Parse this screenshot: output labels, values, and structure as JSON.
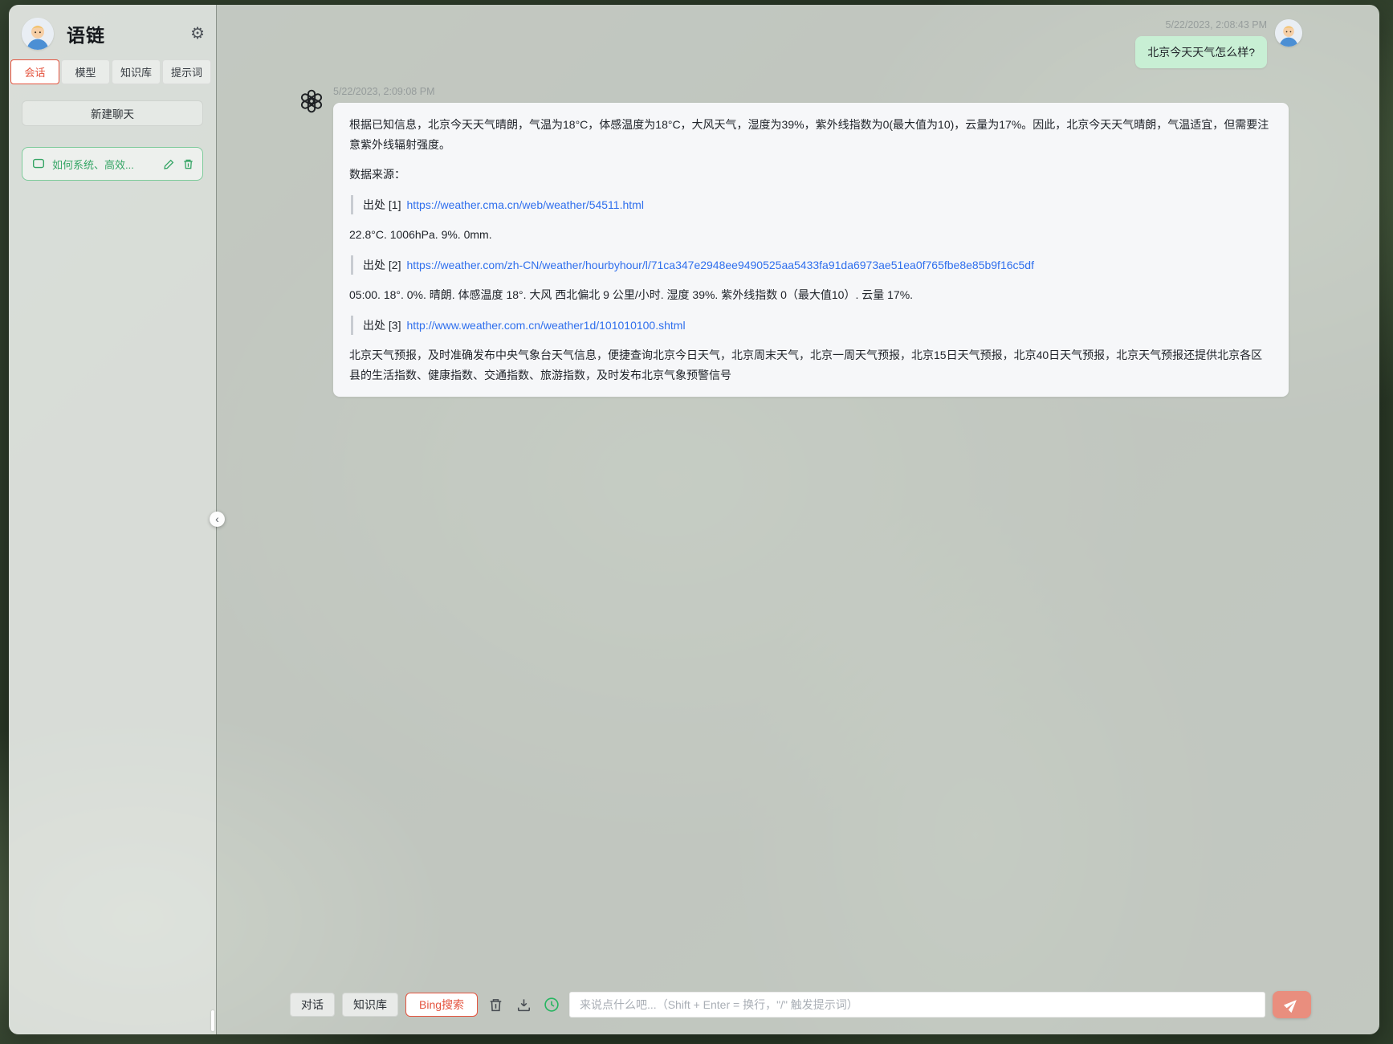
{
  "app": {
    "title": "语链"
  },
  "sidebar": {
    "tabs": [
      {
        "label": "会话",
        "active": true
      },
      {
        "label": "模型",
        "active": false
      },
      {
        "label": "知识库",
        "active": false
      },
      {
        "label": "提示词",
        "active": false
      }
    ],
    "new_chat_label": "新建聊天",
    "conversation": {
      "title": "如何系统、高效..."
    },
    "collapse_glyph": "‹"
  },
  "chat": {
    "user": {
      "timestamp": "5/22/2023, 2:08:43 PM",
      "text": "北京今天天气怎么样?"
    },
    "assistant": {
      "timestamp": "5/22/2023, 2:09:08 PM",
      "paragraph1": "根据已知信息，北京今天天气晴朗，气温为18°C，体感温度为18°C，大风天气，湿度为39%，紫外线指数为0(最大值为10)，云量为17%。因此，北京今天天气晴朗，气温适宜，但需要注意紫外线辐射强度。",
      "sources_heading": "数据来源：",
      "citations": [
        {
          "label": "出处 [1]",
          "url": "https://weather.cma.cn/web/weather/54511.html",
          "excerpt": "22.8°C. 1006hPa. 9%. 0mm."
        },
        {
          "label": "出处 [2]",
          "url": "https://weather.com/zh-CN/weather/hourbyhour/l/71ca347e2948ee9490525aa5433fa91da6973ae51ea0f765fbe8e85b9f16c5df",
          "excerpt": "05:00. 18°. 0%. 晴朗. 体感温度 18°. 大风 西北偏北 9 公里/小时. 湿度 39%. 紫外线指数 0（最大值10）. 云量 17%."
        },
        {
          "label": "出处 [3]",
          "url": "http://www.weather.com.cn/weather1d/101010100.shtml",
          "excerpt": "北京天气预报，及时准确发布中央气象台天气信息，便捷查询北京今日天气，北京周末天气，北京一周天气预报，北京15日天气预报，北京40日天气预报，北京天气预报还提供北京各区县的生活指数、健康指数、交通指数、旅游指数，及时发布北京气象预警信号"
        }
      ]
    }
  },
  "composer": {
    "mode_buttons": [
      {
        "label": "对话",
        "active": false
      },
      {
        "label": "知识库",
        "active": false
      },
      {
        "label": "Bing搜索",
        "active": true
      }
    ],
    "placeholder": "来说点什么吧...（Shift + Enter = 换行，\"/\" 触发提示词）"
  },
  "colors": {
    "accent_red": "#e4533e",
    "brand_green": "#35a565",
    "link_blue": "#2f6fed",
    "user_bubble_green": "#c8efd4",
    "send_coral": "#e98e7e",
    "clock_green": "#27b561",
    "card_bg": "#f6f7f9"
  }
}
